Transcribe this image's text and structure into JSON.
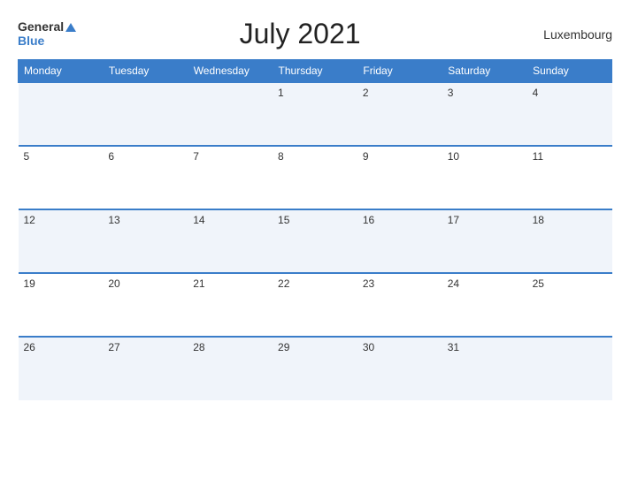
{
  "header": {
    "logo_general": "General",
    "logo_blue": "Blue",
    "title": "July 2021",
    "country": "Luxembourg"
  },
  "calendar": {
    "days_of_week": [
      "Monday",
      "Tuesday",
      "Wednesday",
      "Thursday",
      "Friday",
      "Saturday",
      "Sunday"
    ],
    "weeks": [
      [
        "",
        "",
        "",
        "1",
        "2",
        "3",
        "4"
      ],
      [
        "5",
        "6",
        "7",
        "8",
        "9",
        "10",
        "11"
      ],
      [
        "12",
        "13",
        "14",
        "15",
        "16",
        "17",
        "18"
      ],
      [
        "19",
        "20",
        "21",
        "22",
        "23",
        "24",
        "25"
      ],
      [
        "26",
        "27",
        "28",
        "29",
        "30",
        "31",
        ""
      ]
    ]
  }
}
